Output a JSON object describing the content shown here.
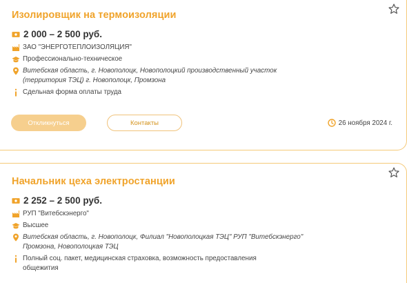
{
  "vacancies": [
    {
      "title": "Изолировщик на термоизоляции",
      "salary": "2 000 – 2 500 руб.",
      "company": "ЗАО \"ЭНЕРГОТЕПЛОИЗОЛЯЦИЯ\"",
      "education": "Профессионально-техническое",
      "location_line1": "Витебская область, г. Новополоцк, Новополоцкий производственный участок",
      "location_line2": "(территория ТЭЦ) г. Новополоцк, Промзона",
      "info": "Сдельная форма оплаты труда",
      "respond_label": "Откликнуться",
      "contacts_label": "Контакты",
      "date": "26 ноября 2024 г."
    },
    {
      "title": "Начальник цеха электростанции",
      "salary": "2 252 – 2 500 руб.",
      "company": "РУП \"Витебскэнерго\"",
      "education": "Высшее",
      "location_line1": "Витебская область, г. Новополоцк, Филиал \"Новополоцкая ТЭЦ\" РУП \"Витебскэнерго\"",
      "location_line2": "Промзона, Новополоцкая ТЭЦ",
      "info_line1": "Полный соц. пакет, медицинская страховка, возможность предоставления",
      "info_line2": "общежития"
    }
  ],
  "icons": {
    "salary": "money-icon",
    "company": "factory-icon",
    "education": "graduation-cap-icon",
    "location": "map-pin-icon",
    "info": "info-icon",
    "date": "clock-icon",
    "favorite": "star-icon"
  },
  "colors": {
    "accent": "#f0a32a",
    "button_fill": "#f6cf8e",
    "border": "#f5c978"
  }
}
